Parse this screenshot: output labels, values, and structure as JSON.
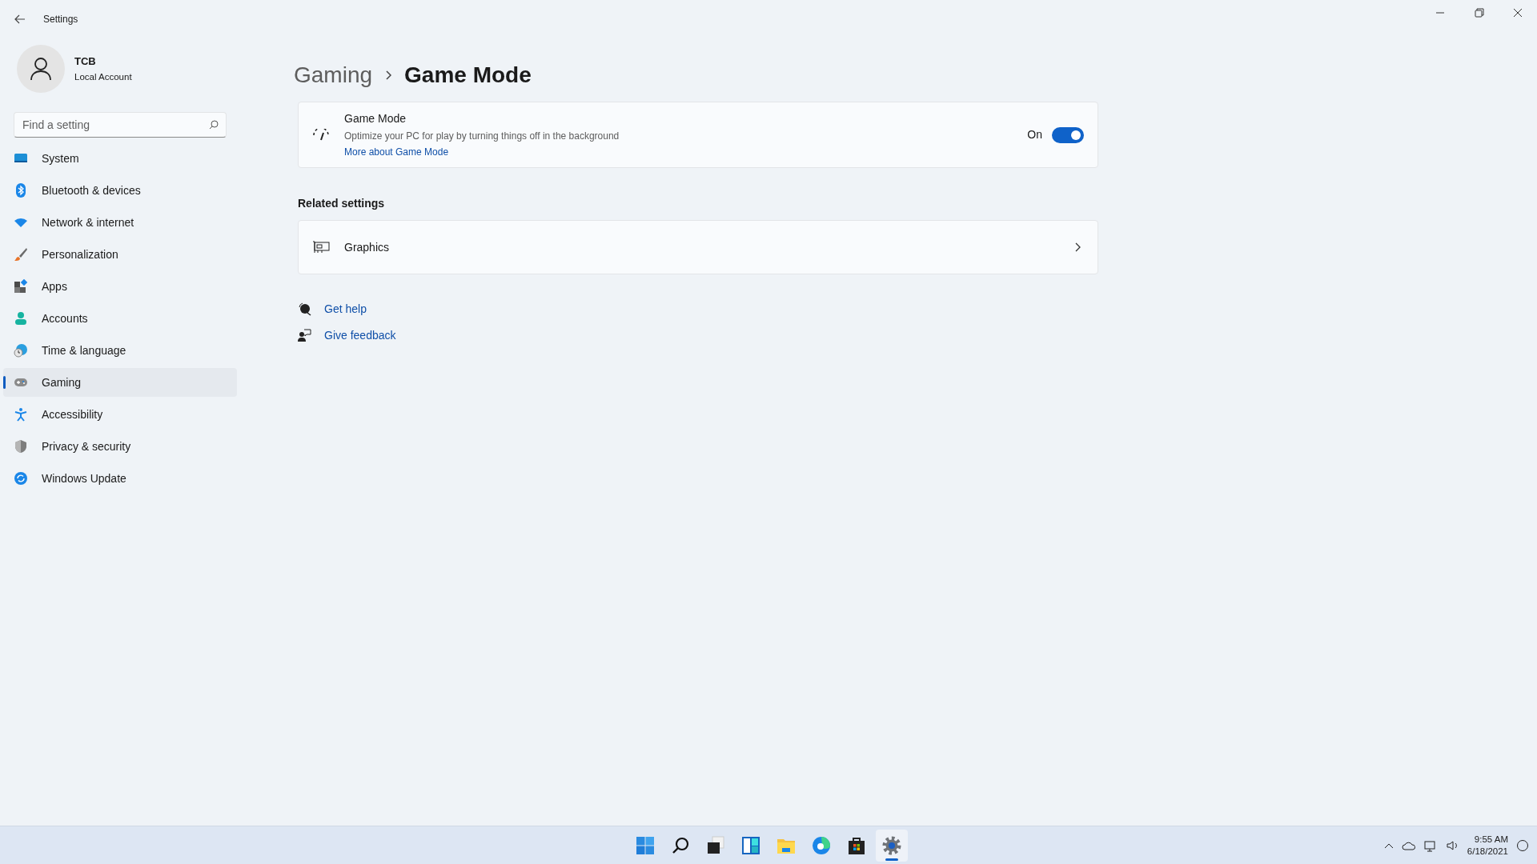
{
  "window": {
    "title": "Settings"
  },
  "account": {
    "name": "TCB",
    "type": "Local Account"
  },
  "search": {
    "placeholder": "Find a setting"
  },
  "nav": [
    {
      "label": "System",
      "selected": false
    },
    {
      "label": "Bluetooth & devices",
      "selected": false
    },
    {
      "label": "Network & internet",
      "selected": false
    },
    {
      "label": "Personalization",
      "selected": false
    },
    {
      "label": "Apps",
      "selected": false
    },
    {
      "label": "Accounts",
      "selected": false
    },
    {
      "label": "Time & language",
      "selected": false
    },
    {
      "label": "Gaming",
      "selected": true
    },
    {
      "label": "Accessibility",
      "selected": false
    },
    {
      "label": "Privacy & security",
      "selected": false
    },
    {
      "label": "Windows Update",
      "selected": false
    }
  ],
  "breadcrumb": {
    "parent": "Gaming",
    "current": "Game Mode"
  },
  "game_mode": {
    "title": "Game Mode",
    "description": "Optimize your PC for play by turning things off in the background",
    "link": "More about Game Mode",
    "state_label": "On",
    "on": true
  },
  "related": {
    "heading": "Related settings",
    "items": [
      {
        "label": "Graphics"
      }
    ]
  },
  "help_links": [
    "Get help",
    "Give feedback"
  ],
  "taskbar": {
    "items": [
      {
        "selected": false
      },
      {
        "selected": false
      },
      {
        "selected": false
      },
      {
        "selected": false
      },
      {
        "selected": false
      },
      {
        "selected": false
      },
      {
        "selected": false
      },
      {
        "selected": true
      }
    ]
  },
  "tray": {
    "time": "9:55 AM",
    "date": "6/18/2021"
  }
}
